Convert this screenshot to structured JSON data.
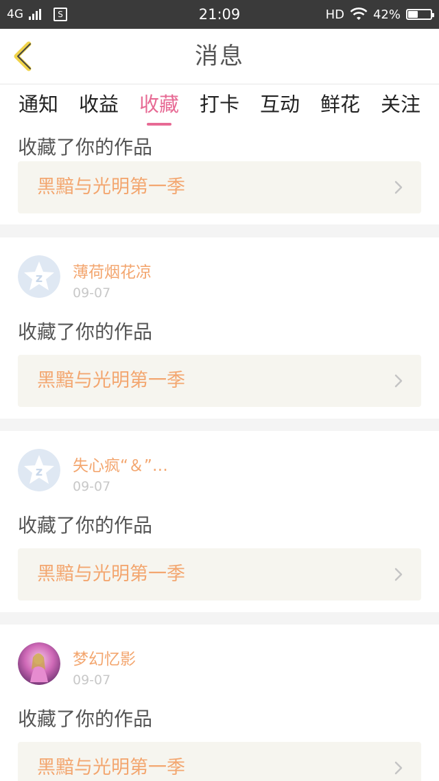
{
  "status_bar": {
    "network": "4G",
    "s_badge": "S",
    "time": "21:09",
    "hd": "HD",
    "battery_text": "42%",
    "battery_level": 0.42
  },
  "header": {
    "title": "消息",
    "back_icon": "chevron-left-icon"
  },
  "tabs": [
    {
      "label": "通知",
      "active": false
    },
    {
      "label": "收益",
      "active": false
    },
    {
      "label": "收藏",
      "active": true
    },
    {
      "label": "打卡",
      "active": false
    },
    {
      "label": "互动",
      "active": false
    },
    {
      "label": "鲜花",
      "active": false
    },
    {
      "label": "关注",
      "active": false
    }
  ],
  "colors": {
    "accent": "#e76a94",
    "username": "#f3a66f",
    "work_title": "#f3a66f",
    "status_bar_bg": "#3a3a3a"
  },
  "notifications": [
    {
      "user": "",
      "date": "",
      "action": "收藏了你的作品",
      "work": "黑黯与光明第一季",
      "avatar": ""
    },
    {
      "user": "薄荷烟花凉",
      "date": "09-07",
      "action": "收藏了你的作品",
      "work": "黑黯与光明第一季",
      "avatar": "qq-default-avatar-icon"
    },
    {
      "user": "失心疯“＆”…",
      "date": "09-07",
      "action": "收藏了你的作品",
      "work": "黑黯与光明第一季",
      "avatar": "qq-default-avatar-icon"
    },
    {
      "user": "梦幻忆影",
      "date": "09-07",
      "action": "收藏了你的作品",
      "work": "黑黯与光明第一季",
      "avatar": "user-photo-avatar"
    }
  ]
}
